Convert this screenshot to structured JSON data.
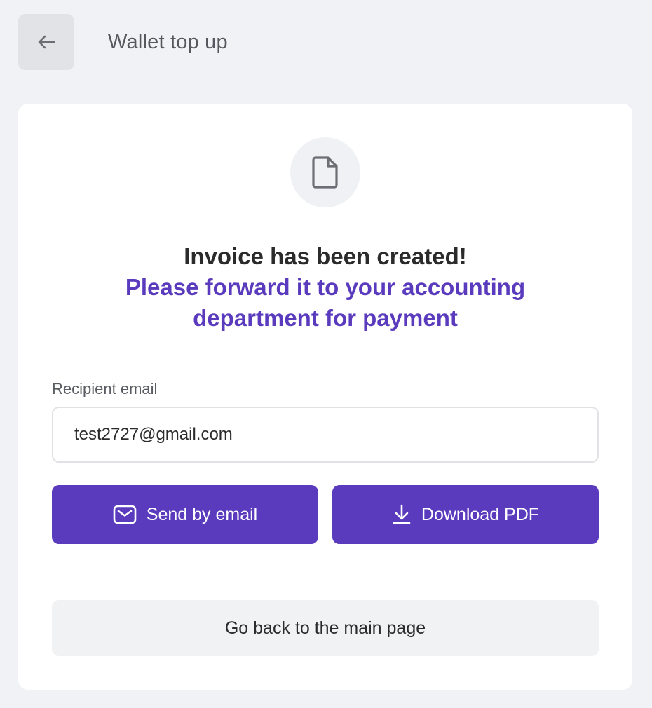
{
  "header": {
    "back_icon": "arrow-left-icon",
    "title": "Wallet top up"
  },
  "card": {
    "status_icon": "document-icon",
    "heading": "Invoice has been created!",
    "subheading": "Please forward it to your accounting department for payment",
    "email_label": "Recipient email",
    "email_value": "test2727@gmail.com",
    "send_button": {
      "label": "Send by email",
      "icon": "envelope-icon"
    },
    "download_button": {
      "label": "Download PDF",
      "icon": "download-icon"
    },
    "back_main_label": "Go back to the main page"
  },
  "colors": {
    "accent": "#5a3bbd",
    "background": "#f1f2f5",
    "card": "#ffffff"
  }
}
